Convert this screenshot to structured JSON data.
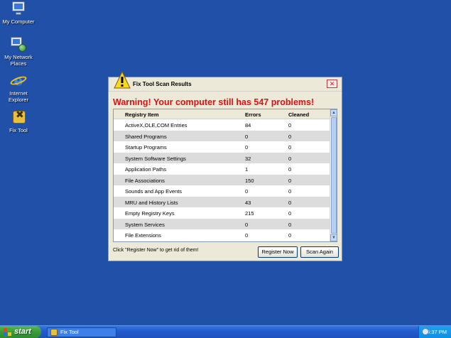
{
  "desktop": {
    "icons": [
      {
        "label": "My Computer",
        "icon": "my-computer-icon"
      },
      {
        "label": "My Network Places",
        "icon": "network-places-icon"
      },
      {
        "label": "Internet Explorer",
        "icon": "internet-explorer-icon"
      },
      {
        "label": "Fix Tool",
        "icon": "fix-tool-icon"
      }
    ],
    "background_color": "#2050a8"
  },
  "dialog": {
    "title": "Fix Tool Scan Results",
    "close_label": "✕",
    "warning": "Warning! Your computer still has 547 problems!",
    "warning_color": "#e01010",
    "columns": [
      "Registry Item",
      "Errors",
      "Cleaned"
    ],
    "rows": [
      [
        "ActiveX,OLE,COM Entries",
        "84",
        "0"
      ],
      [
        "Shared Programs",
        "0",
        "0"
      ],
      [
        "Startup Programs",
        "0",
        "0"
      ],
      [
        "System Software Settings",
        "32",
        "0"
      ],
      [
        "Application Paths",
        "1",
        "0"
      ],
      [
        "File Associations",
        "150",
        "0"
      ],
      [
        "Sounds and App Events",
        "0",
        "0"
      ],
      [
        "MRU and History Lists",
        "43",
        "0"
      ],
      [
        "Empty Registry Keys",
        "215",
        "0"
      ],
      [
        "System Services",
        "0",
        "0"
      ],
      [
        "File Extensions",
        "0",
        "0"
      ]
    ],
    "footer_text": "Click \"Register Now\" to get rid of them!",
    "register_label": "Register Now",
    "scan_label": "Scan Again"
  },
  "taskbar": {
    "start_label": "start",
    "task_label": "Fix Tool",
    "clock": "4:37 PM"
  }
}
